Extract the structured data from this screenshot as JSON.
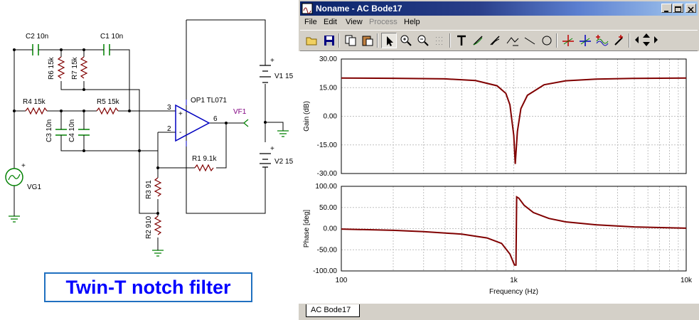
{
  "schematic": {
    "title": "Twin-T notch filter",
    "labels": {
      "c2": "C2 10n",
      "c1": "C1 10n",
      "r6": "R6 15k",
      "r7": "R7 15k",
      "r4": "R4 15k",
      "r5": "R5 15k",
      "c3": "C3 10n",
      "c4": "C4 10n",
      "op1": "OP1 TL071",
      "pin3": "3",
      "pin2": "2",
      "pin6": "6",
      "plus": "+",
      "minus": "-",
      "vf1": "VF1",
      "r1": "R1 9.1k",
      "r3": "R3 91",
      "r2": "R2 910",
      "vg1": "VG1",
      "v1": "V1 15",
      "v2": "V2 15",
      "vplus1": "+",
      "vplus2": "+",
      "vgplus": "+"
    }
  },
  "window": {
    "title": "Noname - AC Bode17",
    "menu": [
      {
        "label": "File",
        "enabled": true
      },
      {
        "label": "Edit",
        "enabled": true
      },
      {
        "label": "View",
        "enabled": true
      },
      {
        "label": "Process",
        "enabled": false
      },
      {
        "label": "Help",
        "enabled": true
      }
    ],
    "tab": "AC Bode17"
  },
  "colors": {
    "trace": "#800000",
    "grid": "#c0c0c0",
    "title_text": "#0000ff",
    "title_border": "#2070c0"
  },
  "chart_data": [
    {
      "type": "line",
      "title": "",
      "ylabel": "Gain (dB)",
      "xlabel": "",
      "x_scale": "log",
      "xlim": [
        100,
        10000
      ],
      "ylim": [
        -30,
        30
      ],
      "yticks": [
        "30.00",
        "15.00",
        "0.00",
        "-15.00",
        "-30.00"
      ],
      "grid": true,
      "series": [
        {
          "x": [
            100,
            200,
            400,
            600,
            800,
            900,
            950,
            1000,
            1020,
            1050,
            1100,
            1200,
            1500,
            2000,
            3000,
            5000,
            10000
          ],
          "y": [
            20,
            19.9,
            19.6,
            18.7,
            16,
            12,
            6,
            -10,
            -25,
            -8,
            4,
            11,
            16.5,
            18.6,
            19.5,
            19.85,
            20
          ]
        }
      ]
    },
    {
      "type": "line",
      "title": "",
      "ylabel": "Phase [deg]",
      "xlabel": "Frequency (Hz)",
      "x_scale": "log",
      "xlim": [
        100,
        10000
      ],
      "ylim": [
        -100,
        100
      ],
      "yticks": [
        "100.00",
        "50.00",
        "0.00",
        "-50.00",
        "-100.00"
      ],
      "xticks": [
        "100",
        "1k",
        "10k"
      ],
      "grid": true,
      "series": [
        {
          "x": [
            100,
            200,
            300,
            500,
            700,
            850,
            950,
            1010,
            1030,
            1040,
            1070,
            1150,
            1300,
            1600,
            2000,
            3000,
            5000,
            10000
          ],
          "y": [
            -1,
            -4,
            -7,
            -13,
            -22,
            -35,
            -60,
            -86,
            -86,
            75,
            72,
            55,
            38,
            24,
            16,
            9,
            4,
            1
          ]
        }
      ]
    }
  ]
}
